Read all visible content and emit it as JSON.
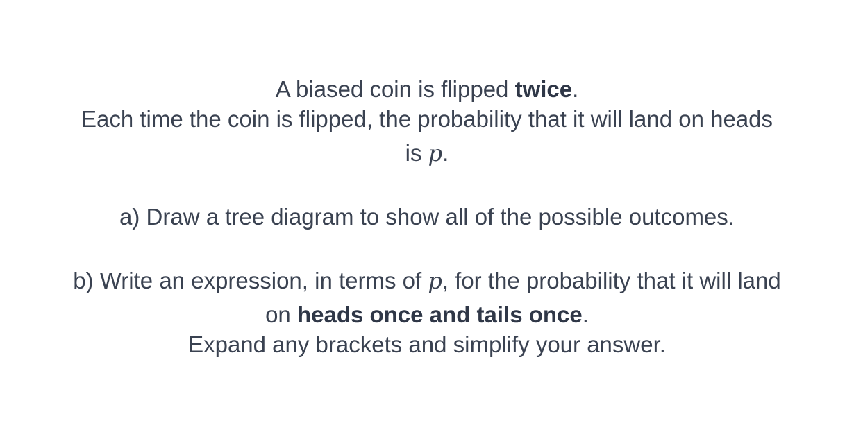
{
  "question": {
    "line1": {
      "pre": "A biased coin is flipped ",
      "bold": "twice",
      "post": "."
    },
    "line2": "Each time the coin is flipped, the probability that it will land on heads",
    "line3": {
      "pre": "is ",
      "var": "p",
      "post": "."
    },
    "part_a": "a) Draw a tree diagram to show all of the possible outcomes.",
    "part_b_line1": {
      "pre": "b) Write an expression, in terms of ",
      "var": "p",
      "post": ", for the probability that it will land"
    },
    "part_b_line2": {
      "pre": "on ",
      "bold": "heads once and tails once",
      "post": "."
    },
    "part_b_line3": "Expand any brackets and simplify your answer."
  }
}
